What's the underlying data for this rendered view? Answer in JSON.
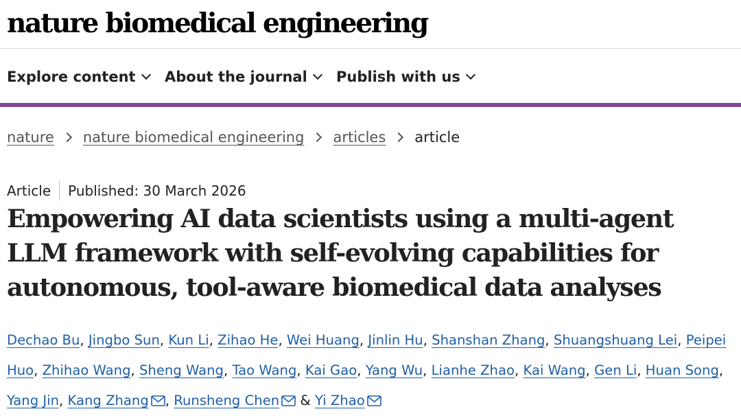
{
  "header": {
    "brand": "nature biomedical engineering"
  },
  "nav": {
    "items": [
      {
        "label": "Explore content",
        "icon": "chevron-down-icon"
      },
      {
        "label": "About the journal",
        "icon": "chevron-down-icon"
      },
      {
        "label": "Publish with us",
        "icon": "chevron-down-icon"
      }
    ]
  },
  "colors": {
    "accent": "#7d4b97",
    "link": "#1f5fa8",
    "text": "#222222"
  },
  "breadcrumb": {
    "items": [
      {
        "label": "nature"
      },
      {
        "label": "nature biomedical engineering"
      },
      {
        "label": "articles"
      }
    ],
    "current": "article"
  },
  "article": {
    "type": "Article",
    "published": "Published: 30 March 2026",
    "title": "Empowering AI data scientists using a multi-agent LLM framework with self-evolving capabilities for autonomous, tool-aware biomedical data analyses",
    "authors": [
      {
        "name": "Dechao Bu"
      },
      {
        "name": "Jingbo Sun"
      },
      {
        "name": "Kun Li"
      },
      {
        "name": "Zihao He"
      },
      {
        "name": "Wei Huang"
      },
      {
        "name": "Jinlin Hu"
      },
      {
        "name": "Shanshan Zhang"
      },
      {
        "name": "Shuangshuang Lei"
      },
      {
        "name": "Peipei Huo"
      },
      {
        "name": "Zhihao Wang"
      },
      {
        "name": "Sheng Wang"
      },
      {
        "name": "Tao Wang"
      },
      {
        "name": "Kai Gao"
      },
      {
        "name": "Yang Wu"
      },
      {
        "name": "Lianhe Zhao"
      },
      {
        "name": "Kai Wang"
      },
      {
        "name": "Gen Li"
      },
      {
        "name": "Huan Song"
      },
      {
        "name": "Yang Jin"
      },
      {
        "name": "Kang Zhang",
        "icon": "envelope-icon"
      },
      {
        "name": "Runsheng Chen",
        "icon": "envelope-icon"
      },
      {
        "name": "Yi Zhao",
        "icon": "envelope-icon"
      }
    ],
    "author_separator": ",",
    "author_last_separator": "&"
  }
}
